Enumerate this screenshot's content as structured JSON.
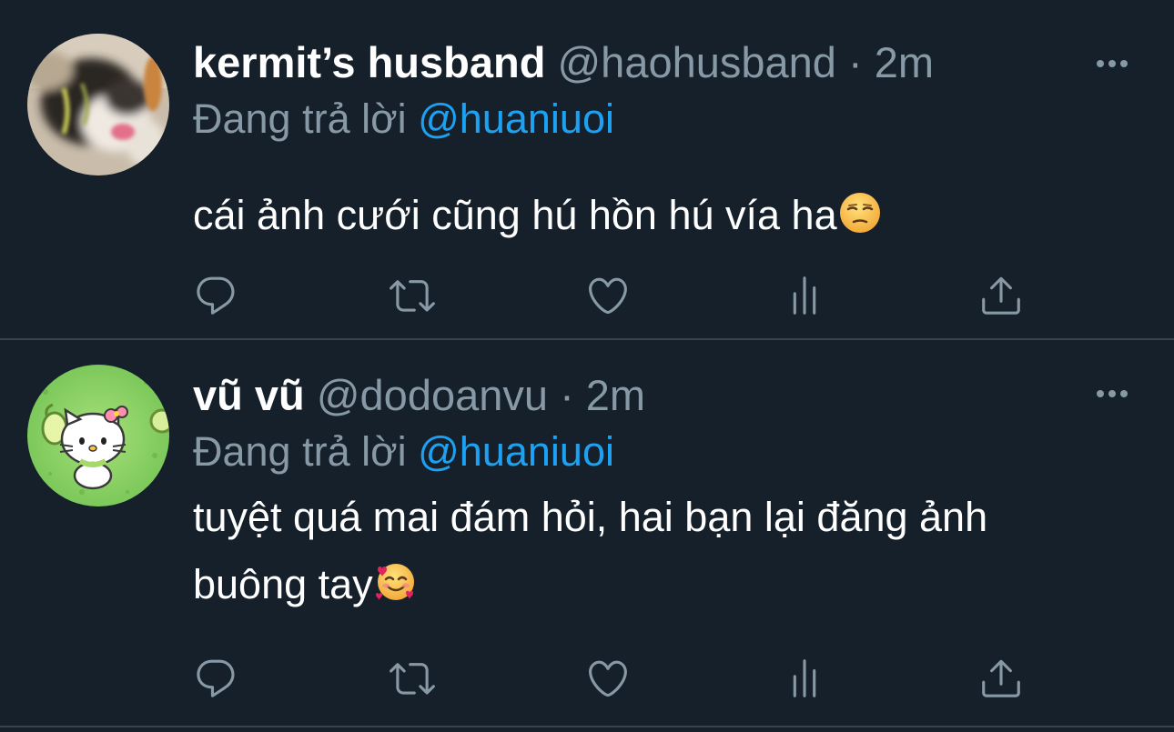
{
  "tweets": [
    {
      "display_name": "kermit’s husband",
      "handle": "@haohusband",
      "separator": "·",
      "time": "2m",
      "replying_prefix": "Đang trả lời",
      "replying_to": "@huaniuoi",
      "text": "cái ảnh cưới cũng hú hồn hú vía ha",
      "emoji": "unamused-face-emoji",
      "avatar": "cat-photo-avatar"
    },
    {
      "display_name": "vũ vũ",
      "handle": "@dodoanvu",
      "separator": "·",
      "time": "2m",
      "replying_prefix": "Đang trả lời",
      "replying_to": "@huaniuoi",
      "text": "tuyệt quá mai đám hỏi, hai bạn lại đăng ảnh buông tay",
      "emoji": "smiling-face-with-hearts-emoji",
      "avatar": "hello-kitty-avatar"
    }
  ],
  "icons": {
    "reply": "reply-icon",
    "retweet": "retweet-icon",
    "like": "heart-icon",
    "analytics": "analytics-icon",
    "share": "share-icon",
    "more": "more-icon"
  },
  "colors": {
    "background": "#15202b",
    "divider": "#38444d",
    "secondary_text": "#8899a6",
    "link": "#1da1f2",
    "primary_text": "#ffffff"
  }
}
